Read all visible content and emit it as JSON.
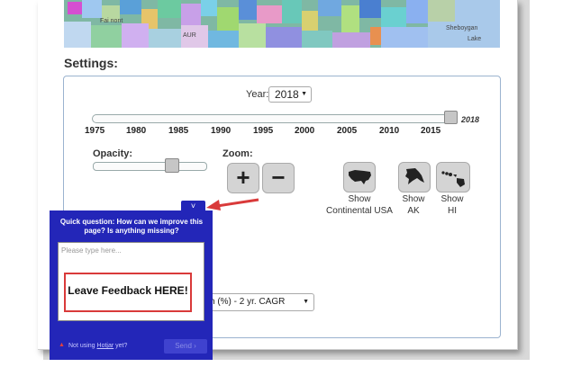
{
  "map": {
    "labels": [
      "Sheboygan",
      "Lake",
      "Fai  nont",
      "AUR"
    ]
  },
  "settings": {
    "title": "Settings:",
    "year_label": "Year:",
    "year_value": "2018",
    "year_slider_current": "2018",
    "year_ticks": [
      "1975",
      "1980",
      "1985",
      "1990",
      "1995",
      "2000",
      "2005",
      "2010",
      "2015"
    ],
    "opacity_label": "Opacity:",
    "opacity_value": 0.7,
    "zoom_label": "Zoom:",
    "zoom_in": "+",
    "zoom_out": "−",
    "views": [
      {
        "line1": "Show",
        "line2": "Continental USA"
      },
      {
        "line1": "Show",
        "line2": "AK"
      },
      {
        "line1": "Show",
        "line2": "HI"
      }
    ],
    "metric_select": "h (%) - 2 yr. CAGR"
  },
  "feedback": {
    "tab_icon": "˅",
    "question": "Quick question: How can we improve this page? Is anything missing?",
    "placeholder": "Please type here...",
    "footer_prefix": "Not using ",
    "footer_link": "Hotjar",
    "footer_suffix": " yet?",
    "send_label": "Send  ›"
  },
  "callout": {
    "text": "Leave Feedback HERE!"
  },
  "colors": {
    "hotjar_blue": "#2326b8",
    "callout_red": "#d93a3a"
  }
}
